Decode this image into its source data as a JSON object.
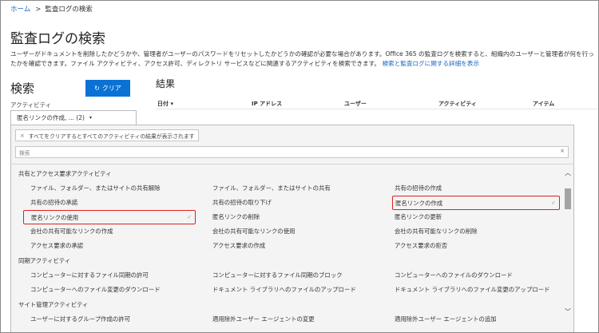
{
  "breadcrumb": {
    "home": "ホーム",
    "separator": ">",
    "current": "監査ログの検索"
  },
  "page_title": "監査ログの検索",
  "description": {
    "text": "ユーザーがドキュメントを削除したかどうかや、管理者がユーザーのパスワードをリセットしたかどうかの確認が必要な場合があります。Office 365 の監査ログを検索すると、組織内のユーザーと管理者が何を行ったかを確認できます。ファイル アクティビティ、アクセス許可、ディレクトリ サービスなどに関連するアクティビティを検索できます。",
    "link": "検索と監査ログに関する詳細を表示"
  },
  "search": {
    "heading": "検索",
    "clear_label": "クリア",
    "activity_label": "アクティビティ",
    "activity_value": "匿名リンクの作成, ... (2)",
    "tag_text": "すべてをクリアするとすべてのアクティビティの結果が表示されます",
    "search_placeholder": "検索"
  },
  "results": {
    "heading": "結果",
    "columns": [
      "日付",
      "IP アドレス",
      "ユーザー",
      "アクティビティ",
      "アイテム"
    ],
    "sort_indicator": "▾"
  },
  "activities": {
    "categories": {
      "sharing": "共有とアクセス要求アクティビティ",
      "sync": "同期アクティビティ",
      "site_admin": "サイト管理アクティビティ"
    },
    "items": {
      "r1": [
        "ファイル、フォルダー、またはサイトの共有解除",
        "ファイル、フォルダー、またはサイトの共有",
        "共有の招待の作成"
      ],
      "r2": [
        "共有の招待の承諾",
        "共有の招待の取り下げ",
        "匿名リンクの作成"
      ],
      "r3": [
        "匿名リンクの使用",
        "匿名リンクの削除",
        "匿名リンクの更新"
      ],
      "r4": [
        "会社の共有可能なリンクの作成",
        "会社の共有可能なリンクの使用",
        "会社の共有可能なリンクの削除"
      ],
      "r5": [
        "アクセス要求の承認",
        "アクセス要求の作成",
        "アクセス要求の拒否"
      ],
      "r6": [
        "コンピューターに対するファイル同期の許可",
        "コンピューターに対するファイル同期のブロック",
        "コンピューターへのファイルのダウンロード"
      ],
      "r7": [
        "コンピューターへのファイル変更のダウンロード",
        "ドキュメント ライブラリへのファイルのアップロード",
        "ドキュメント ライブラリへのファイル変更のアップロード"
      ],
      "r8": [
        "ユーザーに対するグループ作成の許可",
        "適用除外ユーザー エージェントの変更",
        "適用除外ユーザー エージェントの追加"
      ]
    },
    "check_mark": "✓"
  },
  "colors": {
    "accent": "#0a72d4",
    "highlight": "#e01f1f",
    "link": "#1a66c2"
  },
  "icons": {
    "refresh": "↻",
    "close": "×",
    "caret": "▾",
    "scroll_up": "︿",
    "scroll_down": "﹀"
  }
}
